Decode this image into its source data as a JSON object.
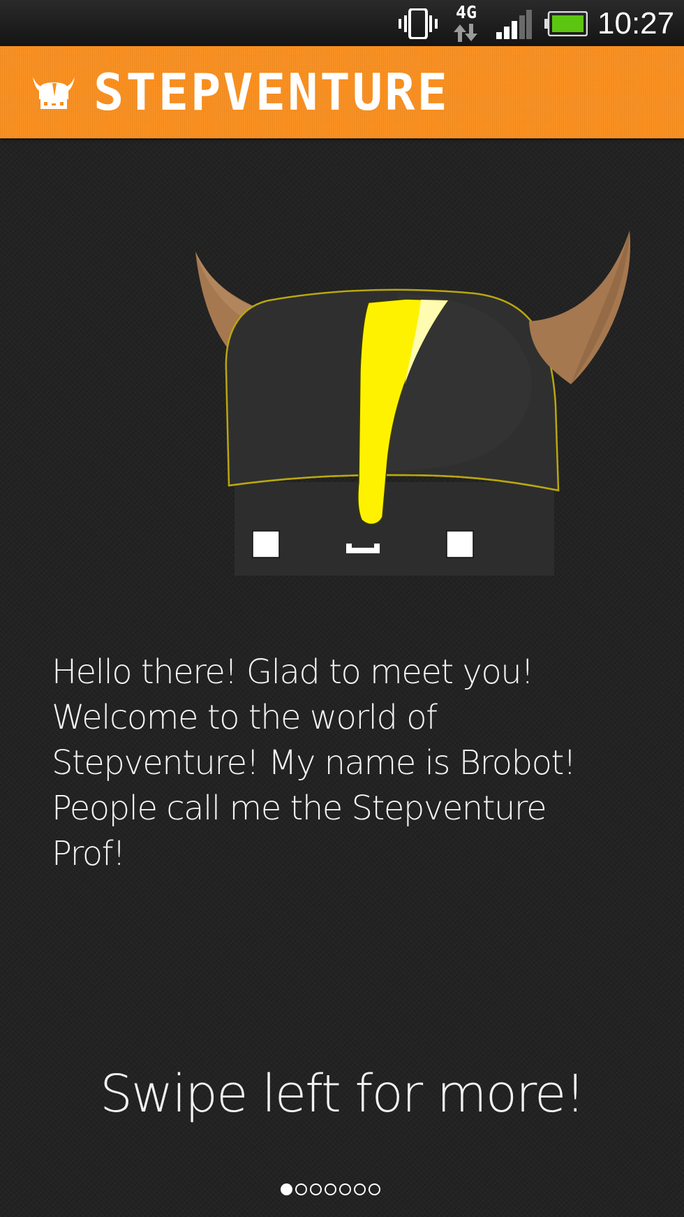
{
  "status_bar": {
    "network_type": "4G",
    "time": "10:27",
    "icons": [
      "vibrate-icon",
      "network-4g-icon",
      "signal-strength-icon",
      "battery-icon"
    ],
    "battery_color": "#5cc511"
  },
  "app_bar": {
    "title": "STEPVENTURE",
    "logo_icon": "viking-helmet-logo-icon",
    "background_color": "#f98f1f"
  },
  "mascot": {
    "icon": "brobot-viking-robot-mascot",
    "helmet_stripe_color": "#fff200",
    "horn_color": "#a57850"
  },
  "intro": {
    "text": "Hello there! Glad to meet you! Welcome to the world of Stepventure! My name is Brobot! People call me the Stepventure Prof!"
  },
  "swipe_hint": "Swipe left for more!",
  "pager": {
    "page_count": 7,
    "current_page": 1
  }
}
